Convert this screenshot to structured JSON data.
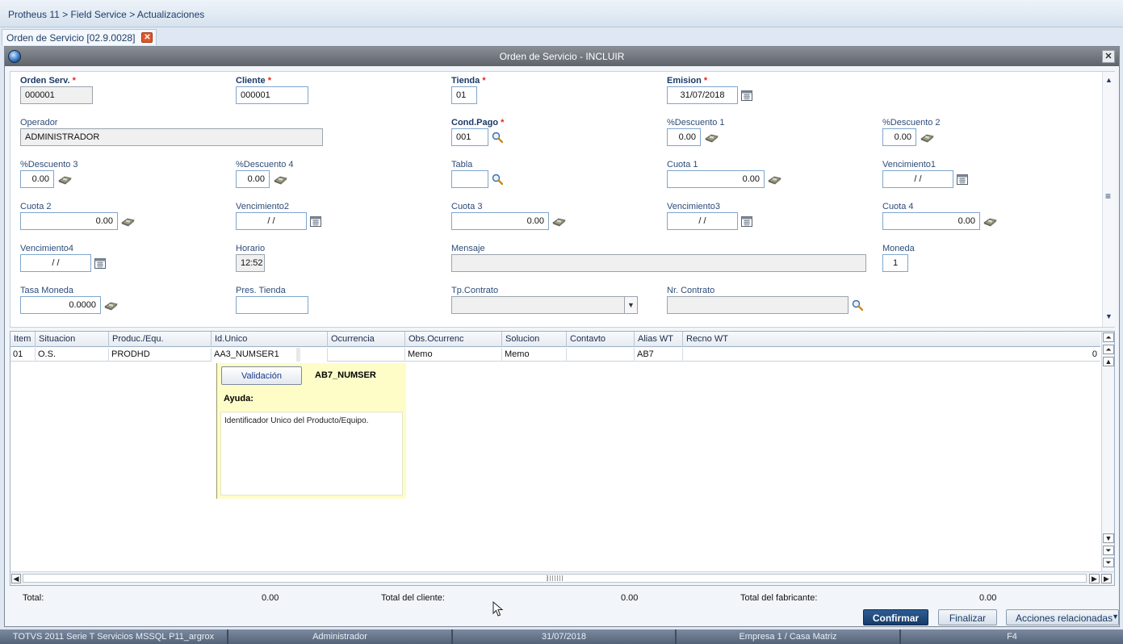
{
  "breadcrumb": "Protheus 11 > Field Service > Actualizaciones",
  "tab": {
    "label": "Orden de Servicio [02.9.0028]"
  },
  "window": {
    "title": "Orden de Servicio - INCLUIR"
  },
  "form": {
    "orden_serv": {
      "label": "Orden Serv.",
      "value": "000001"
    },
    "cliente": {
      "label": "Cliente",
      "value": "000001"
    },
    "tienda": {
      "label": "Tienda",
      "value": "01"
    },
    "emision": {
      "label": "Emision",
      "value": "31/07/2018"
    },
    "operador": {
      "label": "Operador",
      "value": "ADMINISTRADOR"
    },
    "cond_pago": {
      "label": "Cond.Pago",
      "value": "001"
    },
    "descuento1": {
      "label": "%Descuento 1",
      "value": "0.00"
    },
    "descuento2": {
      "label": "%Descuento 2",
      "value": "0.00"
    },
    "descuento3": {
      "label": "%Descuento 3",
      "value": "0.00"
    },
    "descuento4": {
      "label": "%Descuento 4",
      "value": "0.00"
    },
    "tabla": {
      "label": "Tabla",
      "value": ""
    },
    "cuota1": {
      "label": "Cuota 1",
      "value": "0.00"
    },
    "vencimiento1": {
      "label": "Vencimiento1",
      "value": "/ /"
    },
    "cuota2": {
      "label": "Cuota 2",
      "value": "0.00"
    },
    "vencimiento2": {
      "label": "Vencimiento2",
      "value": "/ /"
    },
    "cuota3": {
      "label": "Cuota 3",
      "value": "0.00"
    },
    "vencimiento3": {
      "label": "Vencimiento3",
      "value": "/ /"
    },
    "cuota4": {
      "label": "Cuota 4",
      "value": "0.00"
    },
    "vencimiento4": {
      "label": "Vencimiento4",
      "value": "/ /"
    },
    "horario": {
      "label": "Horario",
      "value": "12:52"
    },
    "mensaje": {
      "label": "Mensaje",
      "value": ""
    },
    "moneda": {
      "label": "Moneda",
      "value": "1"
    },
    "tasa_moneda": {
      "label": "Tasa Moneda",
      "value": "0.0000"
    },
    "pres_tienda": {
      "label": "Pres. Tienda",
      "value": ""
    },
    "tp_contrato": {
      "label": "Tp.Contrato",
      "value": ""
    },
    "nr_contrato": {
      "label": "Nr. Contrato",
      "value": ""
    }
  },
  "grid": {
    "columns": [
      "Item",
      "Situacion",
      "Produc./Equ.",
      "Id.Unico",
      "Ocurrencia",
      "Obs.Ocurrenc",
      "Solucion",
      "Contavto",
      "Alias WT",
      "Recno WT"
    ],
    "row": {
      "item": "01",
      "situacion": "O.S.",
      "producto": "PRODHD",
      "id_unico": "AA3_NUMSER1",
      "ocurrencia": "",
      "obs": "Memo",
      "solucion": "Memo",
      "contavto": "",
      "alias": "AB7",
      "recno": "0"
    }
  },
  "help": {
    "button": "Validación",
    "field": "AB7_NUMSER",
    "title": "Ayuda:",
    "text": "Identificador Unico del Producto/Equipo."
  },
  "totals": {
    "total_label": "Total:",
    "total_value": "0.00",
    "cliente_label": "Total del cliente:",
    "cliente_value": "0.00",
    "fabricante_label": "Total del fabricante:",
    "fabricante_value": "0.00"
  },
  "buttons": {
    "confirm": "Confirmar",
    "finish": "Finalizar",
    "actions": "Acciones relacionadas"
  },
  "status": {
    "system": "TOTVS 2011 Serie T Servicios MSSQL P11_argrox",
    "user": "Administrador",
    "date": "31/07/2018",
    "company": "Empresa 1 / Casa Matriz",
    "key": "F4"
  },
  "icons": [
    "lookup-magnifier-icon",
    "calculator-icon",
    "calendar-icon",
    "close-icon",
    "app-logo-icon"
  ],
  "colors": {
    "accent": "#163b68",
    "required": "#e0261b",
    "help_bg": "#fefdc8",
    "input_border": "#7fa6cc"
  }
}
